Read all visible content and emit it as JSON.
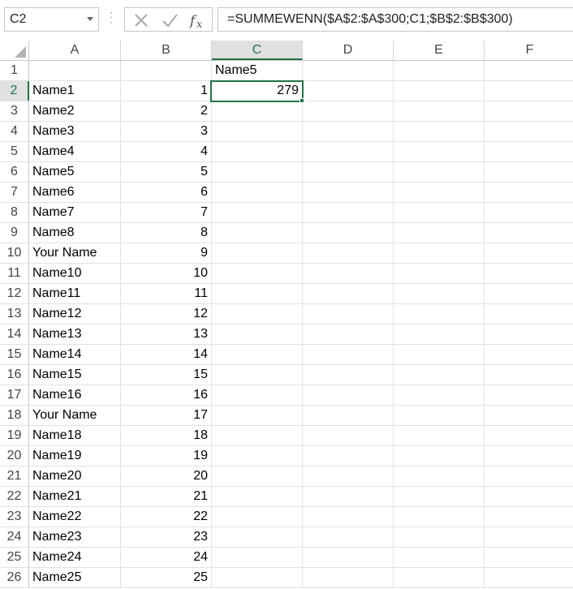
{
  "name_box": {
    "value": "C2"
  },
  "formula_bar": {
    "formula": "=SUMMEWENN($A$2:$A$300;C1;$B$2:$B$300)"
  },
  "columns": [
    "A",
    "B",
    "C",
    "D",
    "E",
    "F"
  ],
  "selected_column": "C",
  "selected_row": "2",
  "rows": [
    {
      "num": "1",
      "a": "",
      "b": "",
      "c": "Name5"
    },
    {
      "num": "2",
      "a": "Name1",
      "b": "1",
      "c": "279"
    },
    {
      "num": "3",
      "a": "Name2",
      "b": "2",
      "c": ""
    },
    {
      "num": "4",
      "a": "Name3",
      "b": "3",
      "c": ""
    },
    {
      "num": "5",
      "a": "Name4",
      "b": "4",
      "c": ""
    },
    {
      "num": "6",
      "a": "Name5",
      "b": "5",
      "c": ""
    },
    {
      "num": "7",
      "a": "Name6",
      "b": "6",
      "c": ""
    },
    {
      "num": "8",
      "a": "Name7",
      "b": "7",
      "c": ""
    },
    {
      "num": "9",
      "a": "Name8",
      "b": "8",
      "c": ""
    },
    {
      "num": "10",
      "a": "Your Name",
      "b": "9",
      "c": ""
    },
    {
      "num": "11",
      "a": "Name10",
      "b": "10",
      "c": ""
    },
    {
      "num": "12",
      "a": "Name11",
      "b": "11",
      "c": ""
    },
    {
      "num": "13",
      "a": "Name12",
      "b": "12",
      "c": ""
    },
    {
      "num": "14",
      "a": "Name13",
      "b": "13",
      "c": ""
    },
    {
      "num": "15",
      "a": "Name14",
      "b": "14",
      "c": ""
    },
    {
      "num": "16",
      "a": "Name15",
      "b": "15",
      "c": ""
    },
    {
      "num": "17",
      "a": "Name16",
      "b": "16",
      "c": ""
    },
    {
      "num": "18",
      "a": "Your Name",
      "b": "17",
      "c": ""
    },
    {
      "num": "19",
      "a": "Name18",
      "b": "18",
      "c": ""
    },
    {
      "num": "20",
      "a": "Name19",
      "b": "19",
      "c": ""
    },
    {
      "num": "21",
      "a": "Name20",
      "b": "20",
      "c": ""
    },
    {
      "num": "22",
      "a": "Name21",
      "b": "21",
      "c": ""
    },
    {
      "num": "23",
      "a": "Name22",
      "b": "22",
      "c": ""
    },
    {
      "num": "24",
      "a": "Name23",
      "b": "23",
      "c": ""
    },
    {
      "num": "25",
      "a": "Name24",
      "b": "24",
      "c": ""
    },
    {
      "num": "26",
      "a": "Name25",
      "b": "25",
      "c": ""
    }
  ]
}
